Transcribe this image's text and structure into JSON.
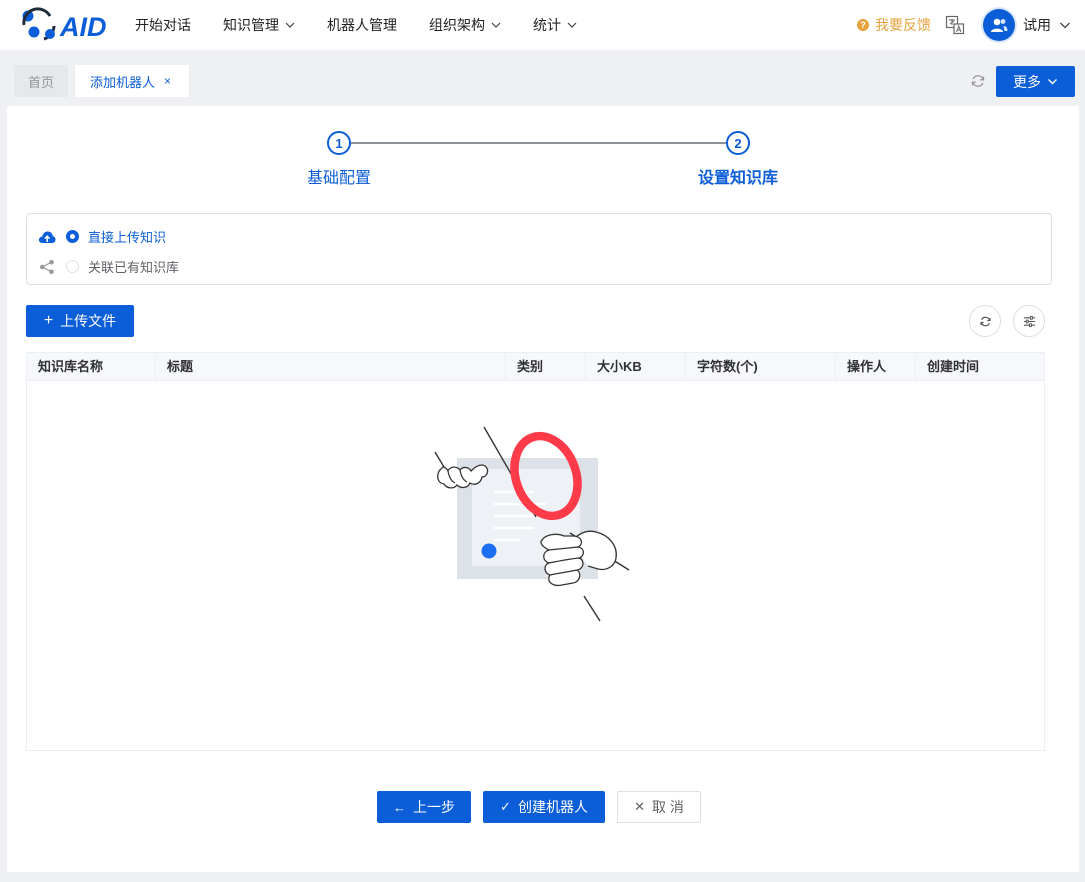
{
  "brand": {
    "logo_text": "AID",
    "accent": "#0b5ed7"
  },
  "nav": {
    "items": [
      {
        "label": "开始对话",
        "has_dropdown": false
      },
      {
        "label": "知识管理",
        "has_dropdown": true
      },
      {
        "label": "机器人管理",
        "has_dropdown": false
      },
      {
        "label": "组织架构",
        "has_dropdown": true
      },
      {
        "label": "统计",
        "has_dropdown": true
      }
    ],
    "feedback_label": "我要反馈",
    "user_name": "试用"
  },
  "tabs": {
    "home_label": "首页",
    "active_label": "添加机器人",
    "close_glyph": "×",
    "more_label": "更多"
  },
  "steps": [
    {
      "number": "1",
      "label": "基础配置"
    },
    {
      "number": "2",
      "label": "设置知识库"
    }
  ],
  "options": {
    "upload_direct": "直接上传知识",
    "link_existing": "关联已有知识库",
    "selected": "upload_direct"
  },
  "toolbar": {
    "upload_label": "上传文件"
  },
  "table": {
    "columns": [
      "知识库名称",
      "标题",
      "类别",
      "大小KB",
      "字符数(个)",
      "操作人",
      "创建时间"
    ],
    "rows": []
  },
  "actions": {
    "prev_label": "上一步",
    "create_label": "创建机器人",
    "cancel_label": "取 消"
  }
}
